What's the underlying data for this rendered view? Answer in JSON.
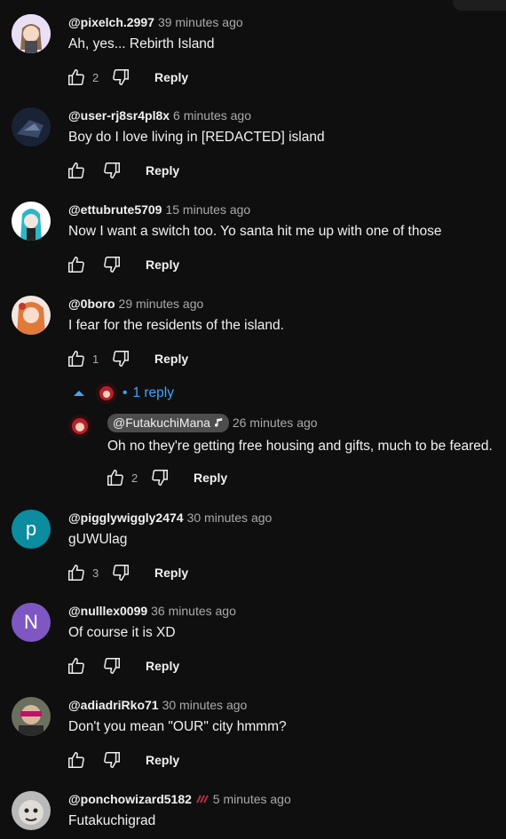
{
  "reply_label": "Reply",
  "comments": [
    {
      "author": "@pixelch.2997",
      "time": "39 minutes ago",
      "text": "Ah, yes... Rebirth Island",
      "likes": "2"
    },
    {
      "author": "@user-rj8sr4pl8x",
      "time": "6 minutes ago",
      "text": "Boy do I love living in [REDACTED] island",
      "likes": ""
    },
    {
      "author": "@ettubrute5709",
      "time": "15 minutes ago",
      "text": "Now I want a switch too. Yo santa hit me up with one of those",
      "likes": ""
    },
    {
      "author": "@0boro",
      "time": "29 minutes ago",
      "text": "I fear for the residents of the island.",
      "likes": "1"
    },
    {
      "author": "@pigglywiggly2474",
      "time": "30 minutes ago",
      "text": "gUWUlag",
      "likes": "3",
      "avatar_letter": "p"
    },
    {
      "author": "@nulllex0099",
      "time": "36 minutes ago",
      "text": "Of course it is XD",
      "likes": "",
      "avatar_letter": "N"
    },
    {
      "author": "@adiadriRko71",
      "time": "30 minutes ago",
      "text": "Don't you mean \"OUR\" city hmmm?",
      "likes": ""
    },
    {
      "author": "@ponchowizard5182",
      "time": "5 minutes ago",
      "text": "Futakuchigrad",
      "likes": ""
    }
  ],
  "replies_toggle": {
    "label": "1 reply",
    "separator": "•"
  },
  "reply": {
    "author": "@FutakuchiMana",
    "time": "26 minutes ago",
    "text": "Oh no they're getting free housing and gifts, much to be feared.",
    "likes": "2"
  },
  "colors": {
    "background": "#0f0f0f",
    "link": "#3ea6ff",
    "p_avatar": "#0b8c9f",
    "n_avatar": "#7e57c2"
  }
}
